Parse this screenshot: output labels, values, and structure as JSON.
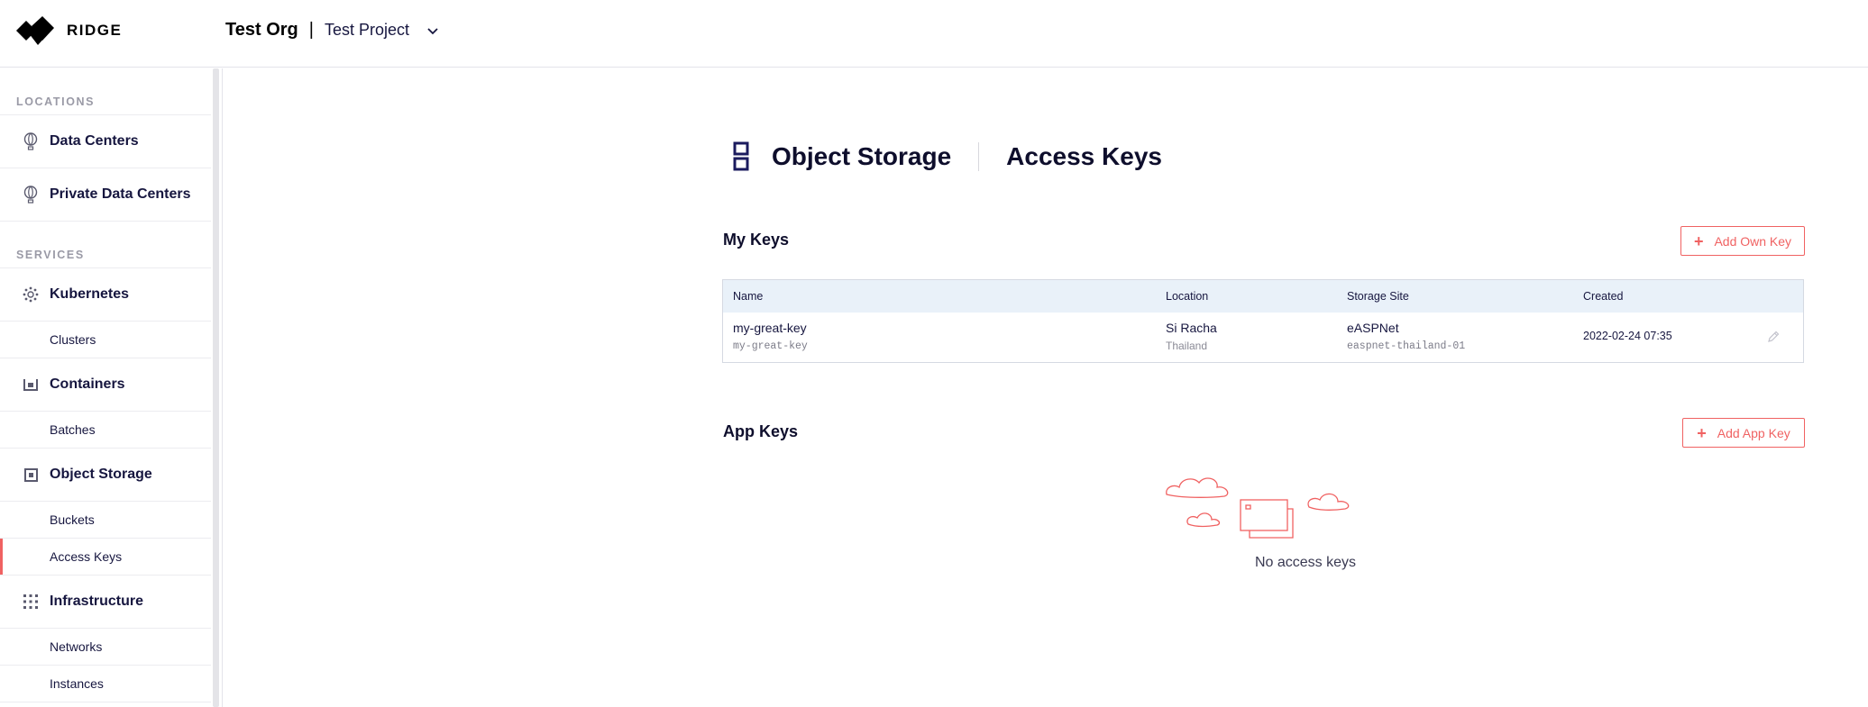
{
  "header": {
    "brand": "RIDGE",
    "org": "Test Org",
    "separator": "|",
    "project": "Test Project"
  },
  "sidebar": {
    "sections": [
      {
        "title": "LOCATIONS"
      },
      {
        "title": "SERVICES"
      }
    ],
    "items": {
      "data_centers": "Data Centers",
      "private_data_centers": "Private Data Centers",
      "kubernetes": "Kubernetes",
      "clusters": "Clusters",
      "containers": "Containers",
      "batches": "Batches",
      "object_storage": "Object Storage",
      "buckets": "Buckets",
      "access_keys": "Access Keys",
      "infrastructure": "Infrastructure",
      "networks": "Networks",
      "instances": "Instances"
    },
    "active_item": "Access Keys"
  },
  "page": {
    "title": "Object Storage",
    "subtitle": "Access Keys"
  },
  "my_keys": {
    "title": "My Keys",
    "add_button": "Add Own Key",
    "columns": [
      "Name",
      "Location",
      "Storage Site",
      "Created"
    ],
    "rows": [
      {
        "name": "my-great-key",
        "id": "my-great-key",
        "location": "Si Racha",
        "country": "Thailand",
        "site": "eASPNet",
        "site_id": "easpnet-thailand-01",
        "created": "2022-02-24 07:35"
      }
    ]
  },
  "app_keys": {
    "title": "App Keys",
    "add_button": "Add App Key",
    "empty_text": "No access keys"
  },
  "colors": {
    "accent": "#f06262",
    "text": "#16163f",
    "table_header_bg": "#e9f1f9"
  }
}
